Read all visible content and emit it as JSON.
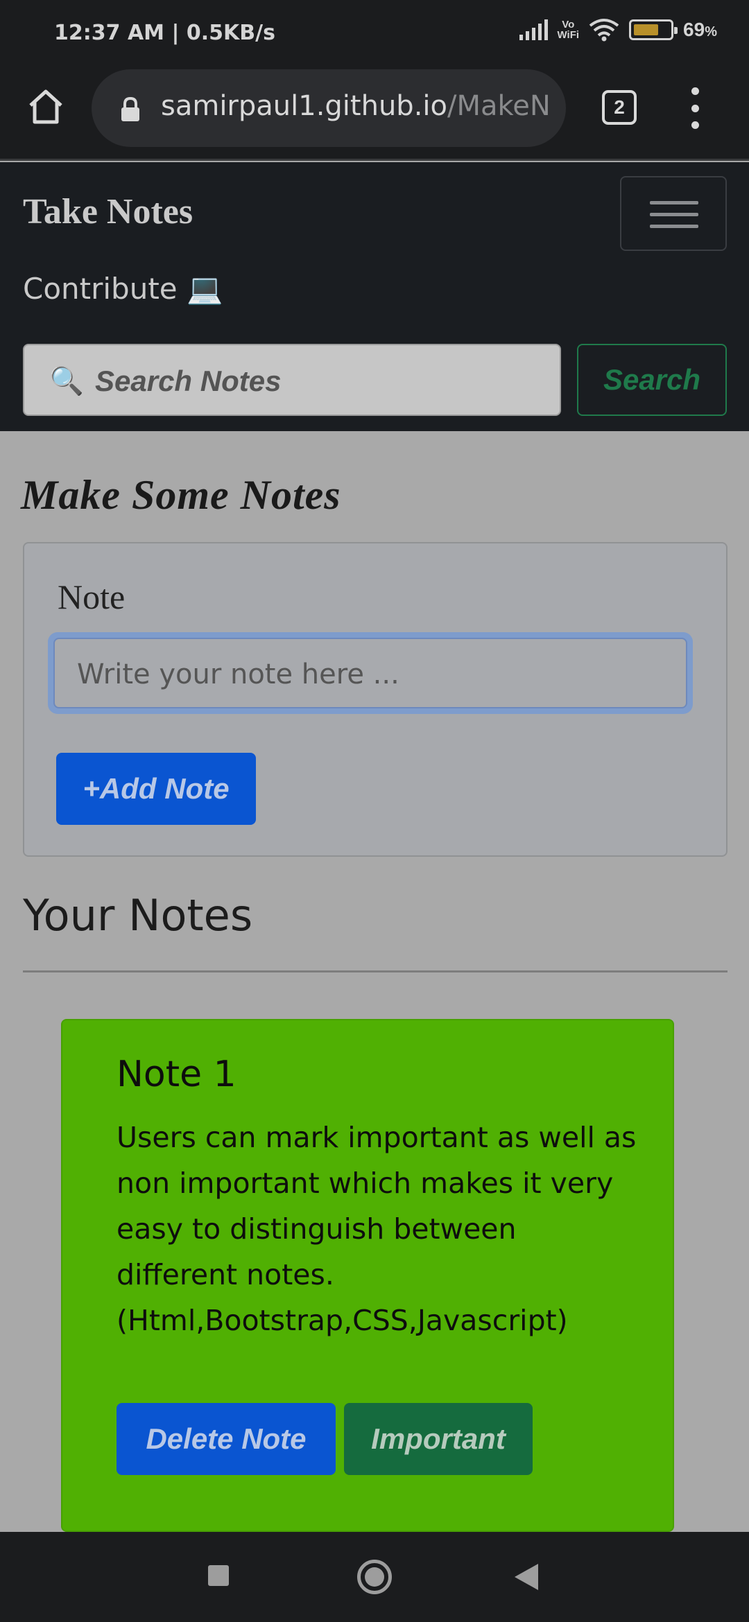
{
  "status_bar": {
    "time": "12:37 AM | 0.5KB/s",
    "vowifi_top": "Vo",
    "vowifi_bottom": "WiFi",
    "battery_percent": "69",
    "battery_percent_symbol": "%",
    "battery_level": 0.69
  },
  "browser": {
    "url_main": "samirpaul1.github.io",
    "url_path": "/MakeN",
    "tab_count": "2"
  },
  "navbar": {
    "brand": "Take Notes",
    "contribute": "Contribute 💻",
    "search_icon": "🔍",
    "search_placeholder": "Search Notes",
    "search_button": "Search"
  },
  "main": {
    "heading": "Make Some Notes",
    "note_label": "Note",
    "note_placeholder": "Write your note here ...",
    "add_button": "+Add Note",
    "your_notes_heading": "Your Notes"
  },
  "notes": [
    {
      "title": "Note 1",
      "text": "Users can mark important as well as non important which makes it very easy to distinguish between different notes. (Html,Bootstrap,CSS,Javascript)",
      "delete_label": "Delete Note",
      "important_label": "Important",
      "color": "#50b003"
    }
  ],
  "colors": {
    "primary": "#0a55d1",
    "success": "#156b3e",
    "note_bg": "#50b003",
    "navbar_bg": "#1a1d21"
  }
}
